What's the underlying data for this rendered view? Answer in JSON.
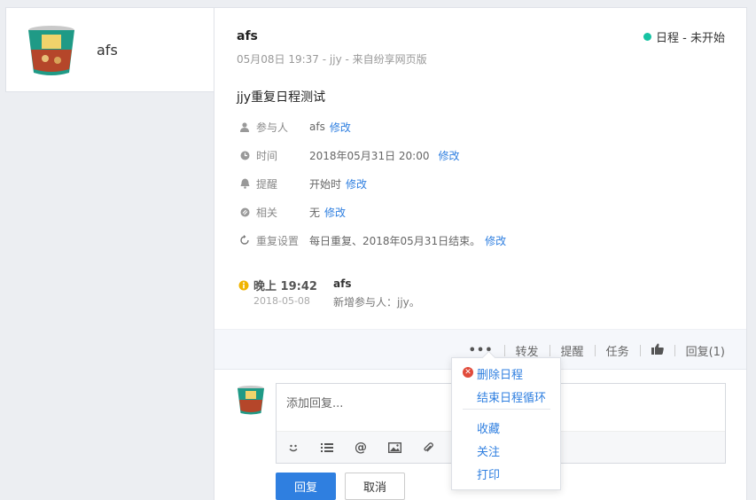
{
  "profile": {
    "name": "afs"
  },
  "post": {
    "author": "afs",
    "meta": "05月08日 19:37 - jjy - 来自纷享网页版",
    "status_label": "日程 - 未开始",
    "status_color": "#17c3a3",
    "title": "jjy重复日程测试"
  },
  "fields": [
    {
      "icon": "person-icon",
      "label": "参与人",
      "value": "afs",
      "edit": "修改"
    },
    {
      "icon": "clock-icon",
      "label": "时间",
      "value": "2018年05月31日 20:00",
      "edit": "修改"
    },
    {
      "icon": "bell-icon",
      "label": "提醒",
      "value": "开始时",
      "edit": "修改"
    },
    {
      "icon": "link-icon",
      "label": "相关",
      "value": "无",
      "edit": "修改"
    },
    {
      "icon": "repeat-icon",
      "label": "重复设置",
      "value": "每日重复、2018年05月31日结束。",
      "edit": "修改"
    }
  ],
  "activity": {
    "time": "晚上 19:42",
    "date": "2018-05-08",
    "user": "afs",
    "text": "新增参与人：jjy。"
  },
  "actions": {
    "more": "•••",
    "forward": "转发",
    "remind": "提醒",
    "task": "任务",
    "reply": "回复(1)"
  },
  "reply": {
    "placeholder": "添加回复...",
    "submit": "回复",
    "cancel": "取消"
  },
  "dropdown": {
    "delete": "删除日程",
    "end_loop": "结束日程循环",
    "favorite": "收藏",
    "follow": "关注",
    "print": "打印"
  },
  "colors": {
    "accent": "#2f7fe0",
    "danger": "#e14b3b"
  }
}
